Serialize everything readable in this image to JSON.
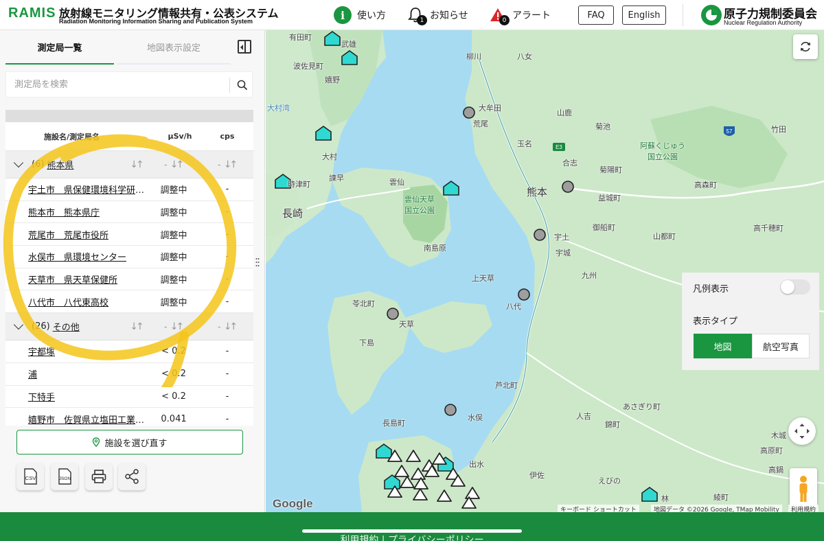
{
  "header": {
    "brand": "RAMIS",
    "title": "放射線モニタリング情報共有・公表システム",
    "subtitle": "Radiation Monitoring Information Sharing and Publication System",
    "help_label": "使い方",
    "notice_label": "お知らせ",
    "notice_count": "1",
    "alert_label": "アラート",
    "alert_count": "0",
    "faq_label": "FAQ",
    "english_label": "English",
    "org_name": "原子力規制委員会",
    "org_name_en": "Nuclear Regulation Authority",
    "accent_color": "#1a9640"
  },
  "sidebar": {
    "tabs": [
      {
        "label": "測定局一覧",
        "active": true
      },
      {
        "label": "地図表示設定",
        "active": false
      }
    ],
    "search_placeholder": "測定局を検索",
    "table": {
      "col_name": "施設名/測定局名",
      "col_usv": "µSv/h",
      "col_cps": "cps",
      "groups": [
        {
          "count": "(6)",
          "name": "熊本県",
          "dash1": "-",
          "dash2": "-",
          "rows": [
            {
              "name": "宇土市　県保健環境科学研究所",
              "usv": "調整中",
              "cps": "-"
            },
            {
              "name": "熊本市　熊本県庁",
              "usv": "調整中",
              "cps": "-"
            },
            {
              "name": "荒尾市　荒尾市役所",
              "usv": "調整中",
              "cps": "-"
            },
            {
              "name": "水俣市　県環境センター",
              "usv": "調整中",
              "cps": "-"
            },
            {
              "name": "天草市　県天草保健所",
              "usv": "調整中",
              "cps": "-"
            },
            {
              "name": "八代市　八代東高校",
              "usv": "調整中",
              "cps": "-"
            }
          ]
        },
        {
          "count": "(26)",
          "name": "その他",
          "dash1": "-",
          "dash2": "-",
          "rows": [
            {
              "name": "宇都塚",
              "usv": "< 0.2",
              "cps": "-"
            },
            {
              "name": "浦",
              "usv": "< 0.2",
              "cps": "-"
            },
            {
              "name": "下特手",
              "usv": "< 0.2",
              "cps": "-"
            },
            {
              "name": "嬉野市　佐賀県立塩田工業高校",
              "usv": "0.041",
              "cps": "-"
            }
          ]
        }
      ]
    },
    "reselect_label": "施設を選び直す",
    "tools": [
      "CSV",
      "JSON",
      "print-icon",
      "share-icon"
    ]
  },
  "map": {
    "labels": {
      "arita": "有田町",
      "takeo": "武雄",
      "yae": "八女",
      "yanagawa": "柳川",
      "hasami": "波佐見町",
      "ureshino": "嬉野",
      "omutacity": "大牟田",
      "arao": "荒尾",
      "yamaga": "山鹿",
      "kikuchi": "菊池",
      "tamana": "玉名",
      "gosi": "合志",
      "kikuyo": "菊陽町",
      "aso_park": "阿蘇くじゅう\n国立公園",
      "takeda": "竹田",
      "omura": "大村",
      "togitsu": "時津町",
      "isahaya": "諫早",
      "unzen": "雲仙",
      "unzen_park": "雲仙天草\n国立公園",
      "nagasaki": "長崎",
      "kumamoto": "熊本",
      "mashiki": "益城町",
      "takamori": "高森町",
      "mifune": "御船町",
      "takachiho": "高千穂町",
      "yamato": "山都町",
      "uto": "宇土",
      "uki": "宇城",
      "minamishimabara": "南島原",
      "kamiamakusa": "上天草",
      "reihoku": "苓北町",
      "amakusa": "天草",
      "shimo": "下島",
      "yatsushiro": "八代",
      "kyushu": "九州",
      "ashikita": "芦北町",
      "asagiri": "あさぎり町",
      "nagashima": "長島町",
      "minamata": "水俣",
      "hitoyoshi": "人吉",
      "nishiki": "錦町",
      "izumi": "出水",
      "isa": "伊佐",
      "ebino": "えびの",
      "kobayashi": "林",
      "takaharu": "高原町",
      "kijo": "木城",
      "takanabe": "高鍋",
      "ayacho": "綾町",
      "omurawan": "大村湾"
    },
    "refresh_label": "refresh-icon",
    "legend_label": "凡例表示",
    "legend_on": false,
    "display_type_label": "表示タイプ",
    "display_types": [
      "地図",
      "航空写真"
    ],
    "display_type_selected": "地図",
    "route_shield": "57",
    "expressway_shield": "E3",
    "google": "Google",
    "attrib_shortcuts": "キーボード ショートカット",
    "attrib_data": "地図データ ©2026 Google, TMap Mobility",
    "attrib_terms": "利用規約"
  },
  "footer": {
    "links": "利用規約 | プライバシーポリシー"
  }
}
